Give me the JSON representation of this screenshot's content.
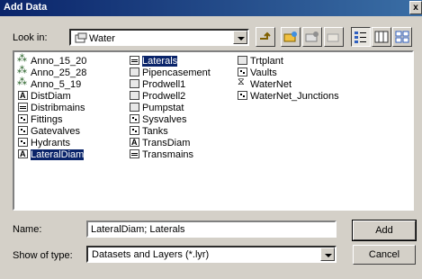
{
  "window": {
    "title": "Add Data",
    "close_glyph": "x"
  },
  "lookin": {
    "label": "Look in:",
    "value": "Water",
    "icon": "geodatabase-icon"
  },
  "toolbar": {
    "buttons": [
      "up-one-level-icon",
      "connect-folder-icon",
      "disconnect-folder-icon",
      "new-folder-icon",
      "list-view-icon",
      "details-view-icon",
      "thumbnails-view-icon"
    ]
  },
  "items": [
    {
      "label": "Anno_15_20",
      "icon": "annotation-icon"
    },
    {
      "label": "Anno_25_28",
      "icon": "annotation-icon"
    },
    {
      "label": "Anno_5_19",
      "icon": "annotation-icon"
    },
    {
      "label": "DistDiam",
      "icon": "text-icon"
    },
    {
      "label": "Distribmains",
      "icon": "line-icon"
    },
    {
      "label": "Fittings",
      "icon": "point-icon"
    },
    {
      "label": "Gatevalves",
      "icon": "point-icon"
    },
    {
      "label": "Hydrants",
      "icon": "point-icon"
    },
    {
      "label": "LateralDiam",
      "icon": "text-icon",
      "selected": true
    },
    {
      "label": "Laterals",
      "icon": "line-icon",
      "selected": true
    },
    {
      "label": "Pipencasement",
      "icon": "polygon-icon"
    },
    {
      "label": "Prodwell1",
      "icon": "polygon-icon"
    },
    {
      "label": "Prodwell2",
      "icon": "polygon-icon"
    },
    {
      "label": "Pumpstat",
      "icon": "polygon-icon"
    },
    {
      "label": "Sysvalves",
      "icon": "point-icon"
    },
    {
      "label": "Tanks",
      "icon": "point-icon"
    },
    {
      "label": "TransDiam",
      "icon": "text-icon"
    },
    {
      "label": "Transmains",
      "icon": "line-icon"
    },
    {
      "label": "Trtplant",
      "icon": "polygon-icon"
    },
    {
      "label": "Vaults",
      "icon": "point-icon"
    },
    {
      "label": "WaterNet",
      "icon": "network-icon"
    },
    {
      "label": "WaterNet_Junctions",
      "icon": "point-icon"
    }
  ],
  "name": {
    "label": "Name:",
    "value": "LateralDiam; Laterals"
  },
  "filetype": {
    "label": "Show of type:",
    "value": "Datasets and Layers (*.lyr)"
  },
  "buttons": {
    "add": "Add",
    "cancel": "Cancel"
  }
}
